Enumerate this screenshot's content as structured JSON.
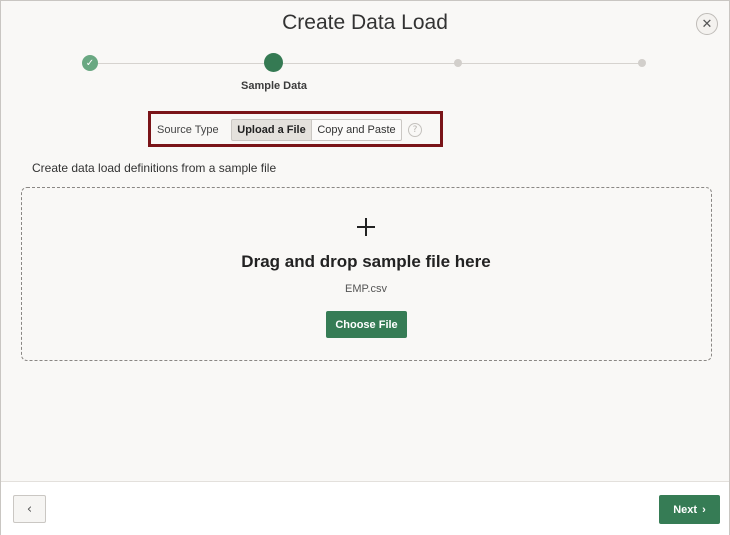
{
  "dialog": {
    "title": "Create Data Load",
    "close_icon": "close-icon"
  },
  "wizard": {
    "steps": [
      {
        "state": "complete",
        "label": ""
      },
      {
        "state": "current",
        "label": "Sample Data"
      },
      {
        "state": "future",
        "label": ""
      },
      {
        "state": "future",
        "label": ""
      }
    ]
  },
  "source_type": {
    "label": "Source Type",
    "options": [
      "Upload a File",
      "Copy and Paste"
    ],
    "selected": "Upload a File",
    "help_icon": "help-icon",
    "help_glyph": "?"
  },
  "description": "Create data load definitions from a sample file",
  "dropzone": {
    "icon": "plus-icon",
    "title": "Drag and drop sample file here",
    "file_name": "EMP.csv",
    "button_label": "Choose File"
  },
  "footer": {
    "back_icon": "chevron-left-icon",
    "next_label": "Next",
    "next_icon": "chevron-right-icon"
  },
  "colors": {
    "accent": "#367c55",
    "highlight_border": "#7a1418",
    "completed_step": "#6aa882"
  }
}
